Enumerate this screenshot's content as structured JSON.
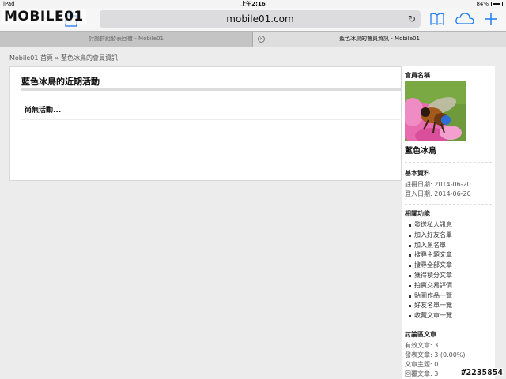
{
  "status_bar": {
    "device": "iPad",
    "time": "上午2:16",
    "battery": "84%"
  },
  "toolbar": {
    "logo": "MOBILE01",
    "url": "mobile01.com"
  },
  "tabs": [
    {
      "label": "討論群組發表回覆 - Mobile01"
    },
    {
      "label": "藍色冰鳥的會員資訊 - Mobile01"
    }
  ],
  "breadcrumb": "Mobile01 首頁 » 藍色冰鳥的會員資訊",
  "activity": {
    "title": "藍色冰鳥的近期活動",
    "empty_text": "尚無活動..."
  },
  "sidebar": {
    "member_name_label": "會員名稱",
    "username": "藍色冰鳥",
    "basic": {
      "heading": "基本資料",
      "register_date": "註冊日期: 2014-06-20",
      "login_date": "登入日期: 2014-06-20"
    },
    "functions": {
      "heading": "相關功能",
      "items": [
        {
          "label": "發送私人訊息"
        },
        {
          "label": "加入好友名單"
        },
        {
          "label": "加入黑名單"
        },
        {
          "label": "搜尋主題文章"
        },
        {
          "label": "搜尋全部文章"
        },
        {
          "label": "獲得積分文章"
        },
        {
          "label": "拍賣交易評價"
        },
        {
          "label": "貼圖作品一覽"
        },
        {
          "label": "好友名單一覽"
        },
        {
          "label": "收藏文章一覽"
        }
      ]
    },
    "forum": {
      "heading": "討論區文章",
      "valid": "有效文章: 3",
      "posts": "發表文章: 3 (0.00%)",
      "topics": "文章主題: 0",
      "replies": "回覆文章: 3"
    }
  },
  "watermark": "#2235854",
  "colors": {
    "background": "#ececec",
    "panel": "#ffffff",
    "url_bar": "#dcdcde",
    "accent_icon": "#1e7cf2"
  }
}
